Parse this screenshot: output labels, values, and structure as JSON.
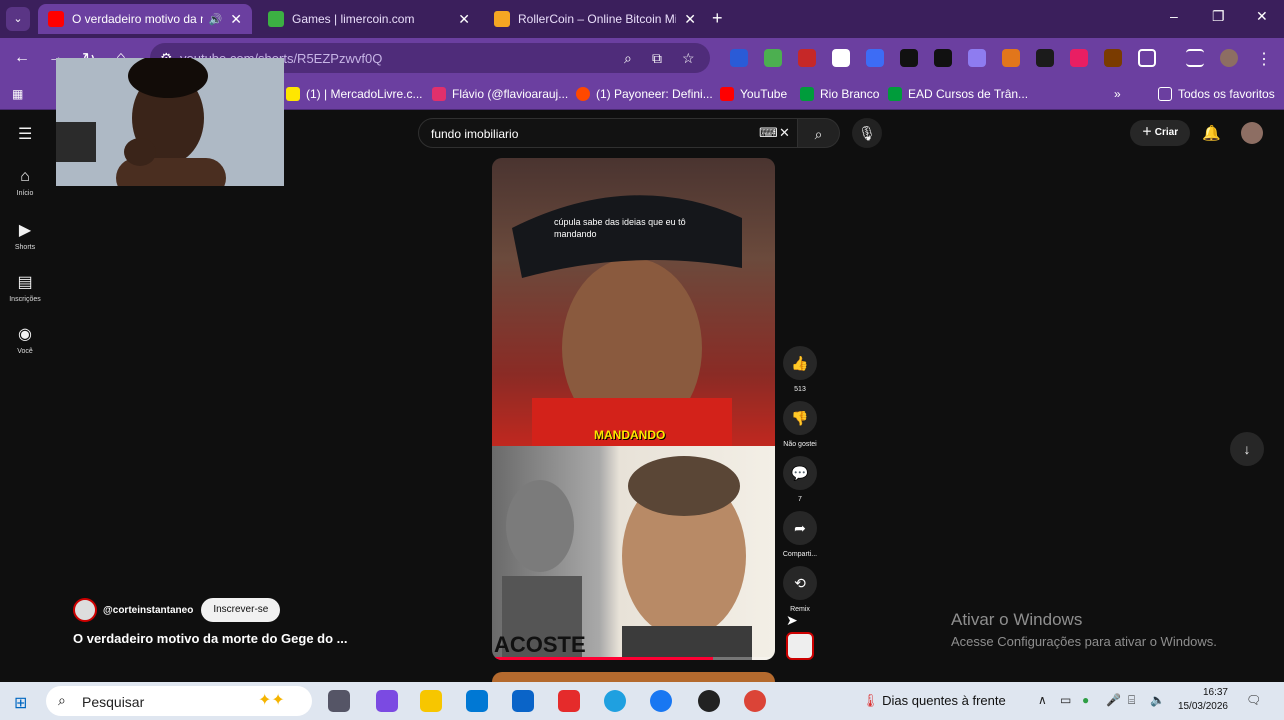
{
  "browser": {
    "tabs": [
      {
        "title": "O verdadeiro motivo da mo",
        "active": true,
        "favicon_color": "#ff0000"
      },
      {
        "title": "Games | limercoin.com",
        "active": false,
        "favicon_color": "#3cb043"
      },
      {
        "title": "RollerCoin – Online Bitcoin Min",
        "active": false,
        "favicon_color": "#f5a623"
      }
    ],
    "new_tab_icon": "+",
    "url": "youtube.com/shorts/R5EZPzwvf0Q",
    "window_controls": {
      "minimize": "–",
      "maximize": "❐",
      "close": "✕"
    },
    "bookmarks": [
      {
        "label": "(1) | MercadoLivre.c...",
        "color": "#ffe600"
      },
      {
        "label": "Flávio (@flavioarauj...",
        "color": "#e1306c"
      },
      {
        "label": "(1) Payoneer: Defini...",
        "color": "#ff4800"
      },
      {
        "label": "YouTube",
        "color": "#ff0000"
      },
      {
        "label": "Rio Branco",
        "color": "#009c3b"
      },
      {
        "label": "EAD Cursos de Trân...",
        "color": "#009c3b"
      }
    ],
    "all_bookmarks": "Todos os favoritos",
    "more_bookmarks": "»"
  },
  "youtube": {
    "search_query": "fundo imobiliario",
    "create_label": "Criar",
    "left_nav": [
      {
        "label": "Início",
        "icon": "⌂"
      },
      {
        "label": "Shorts",
        "icon": "▶"
      },
      {
        "label": "Inscrições",
        "icon": "▤"
      },
      {
        "label": "Você",
        "icon": "◉"
      }
    ],
    "short": {
      "caption": "cúpula sabe das ideias que eu tô mandando",
      "overlay_word": "MANDANDO",
      "channel": "@corteinstantaneo",
      "subscribe_label": "Inscrever-se",
      "title": "O verdadeiro motivo da morte do Gege do ...",
      "progress": 0.78
    },
    "actions": [
      {
        "label": "513",
        "icon": "👍"
      },
      {
        "label": "Não gostei",
        "icon": "👎"
      },
      {
        "label": "7",
        "icon": "💬"
      },
      {
        "label": "Comparti...",
        "icon": "➦"
      },
      {
        "label": "Remix",
        "icon": "⟲"
      }
    ]
  },
  "windows": {
    "activate_title": "Ativar o Windows",
    "activate_sub": "Acesse Configurações para ativar o Windows.",
    "taskbar_search": "Pesquisar",
    "weather": "Dias quentes à frente",
    "time": "16:37",
    "date": "15/03/2026"
  }
}
